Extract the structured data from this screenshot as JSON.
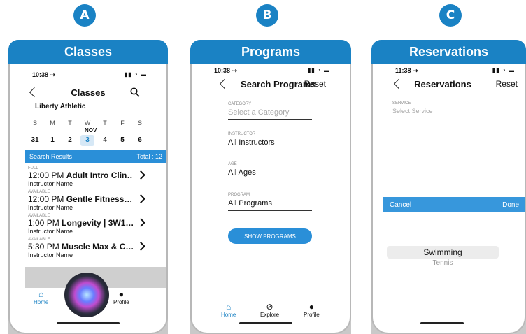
{
  "badges": {
    "a": "A",
    "b": "B",
    "c": "C"
  },
  "colors": {
    "brand": "#1a82c4",
    "accent": "#2a8fd8"
  },
  "panel_a": {
    "card_title": "Classes",
    "time": "10:38 ⇢",
    "status_icons": "▮▮ ◔ ▬",
    "nav_title": "Classes",
    "venue": "Liberty Athletic",
    "weekdays": [
      "S",
      "M",
      "T",
      "W",
      "T",
      "F",
      "S"
    ],
    "month": "NOV",
    "dates": [
      "31",
      "1",
      "2",
      "3",
      "4",
      "5",
      "6"
    ],
    "selected_date": "3",
    "results_label": "Search Results",
    "results_total": "Total : 12",
    "classes": [
      {
        "state": "FULL",
        "time": "12:00 PM",
        "name": "Adult Intro Clin…",
        "instructor": "Instructor Name"
      },
      {
        "state": "AVAILABLE",
        "time": "12:00 PM",
        "name": "Gentle Fitness…",
        "instructor": "Instructor Name"
      },
      {
        "state": "AVAILABLE",
        "time": "1:00 PM",
        "name": "Longevity | 3W1…",
        "instructor": "Instructor Name"
      },
      {
        "state": "AVAILABLE",
        "time": "5:30 PM",
        "name": "Muscle Max & C…",
        "instructor": "Instructor Name"
      }
    ],
    "tabs": {
      "home": "Home",
      "profile": "Profile"
    }
  },
  "panel_b": {
    "card_title": "Programs",
    "time": "10:38 ⇢",
    "status_icons": "▮▮ ◔ ▬",
    "nav_title": "Search Programs",
    "reset": "Reset",
    "fields": [
      {
        "label": "CATEGORY",
        "value": "Select a Category",
        "placeholder": true
      },
      {
        "label": "INSTRUCTOR",
        "value": "All Instructors",
        "placeholder": false
      },
      {
        "label": "AGE",
        "value": "All Ages",
        "placeholder": false
      },
      {
        "label": "PROGRAM",
        "value": "All Programs",
        "placeholder": false
      }
    ],
    "show_button": "SHOW PROGRAMS",
    "tabs": {
      "home": "Home",
      "explore": "Explore",
      "profile": "Profile"
    }
  },
  "panel_c": {
    "card_title": "Reservations",
    "time": "11:38 ⇢",
    "status_icons": "▮▮ ◔ ▬",
    "nav_title": "Reservations",
    "reset": "Reset",
    "field": {
      "label": "SERVICE",
      "placeholder": "Select Service"
    },
    "picker": {
      "cancel": "Cancel",
      "done": "Done",
      "selected": "Swimming",
      "next": "Tennis"
    }
  }
}
